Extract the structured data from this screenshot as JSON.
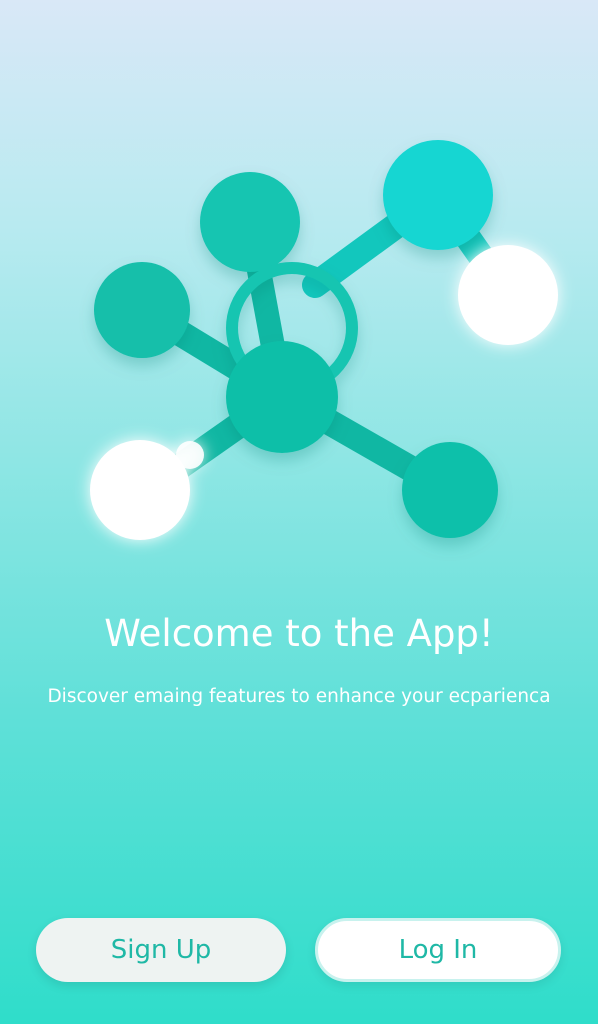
{
  "welcome": {
    "title": "Welcome to the App!",
    "subtitle": "Discover emaing features to enhance your ecparienca"
  },
  "actions": {
    "signup_label": "Sign Up",
    "login_label": "Log In"
  },
  "illustration": {
    "icon": "molecule-network-icon",
    "node_color": "#14c2ad",
    "accent_color": "#19d6d2",
    "glow_color": "#ffffff"
  },
  "theme": {
    "gradient_top": "#d9e8f7",
    "gradient_bottom": "#2fddca",
    "button_text_color": "#1fb8a6"
  }
}
